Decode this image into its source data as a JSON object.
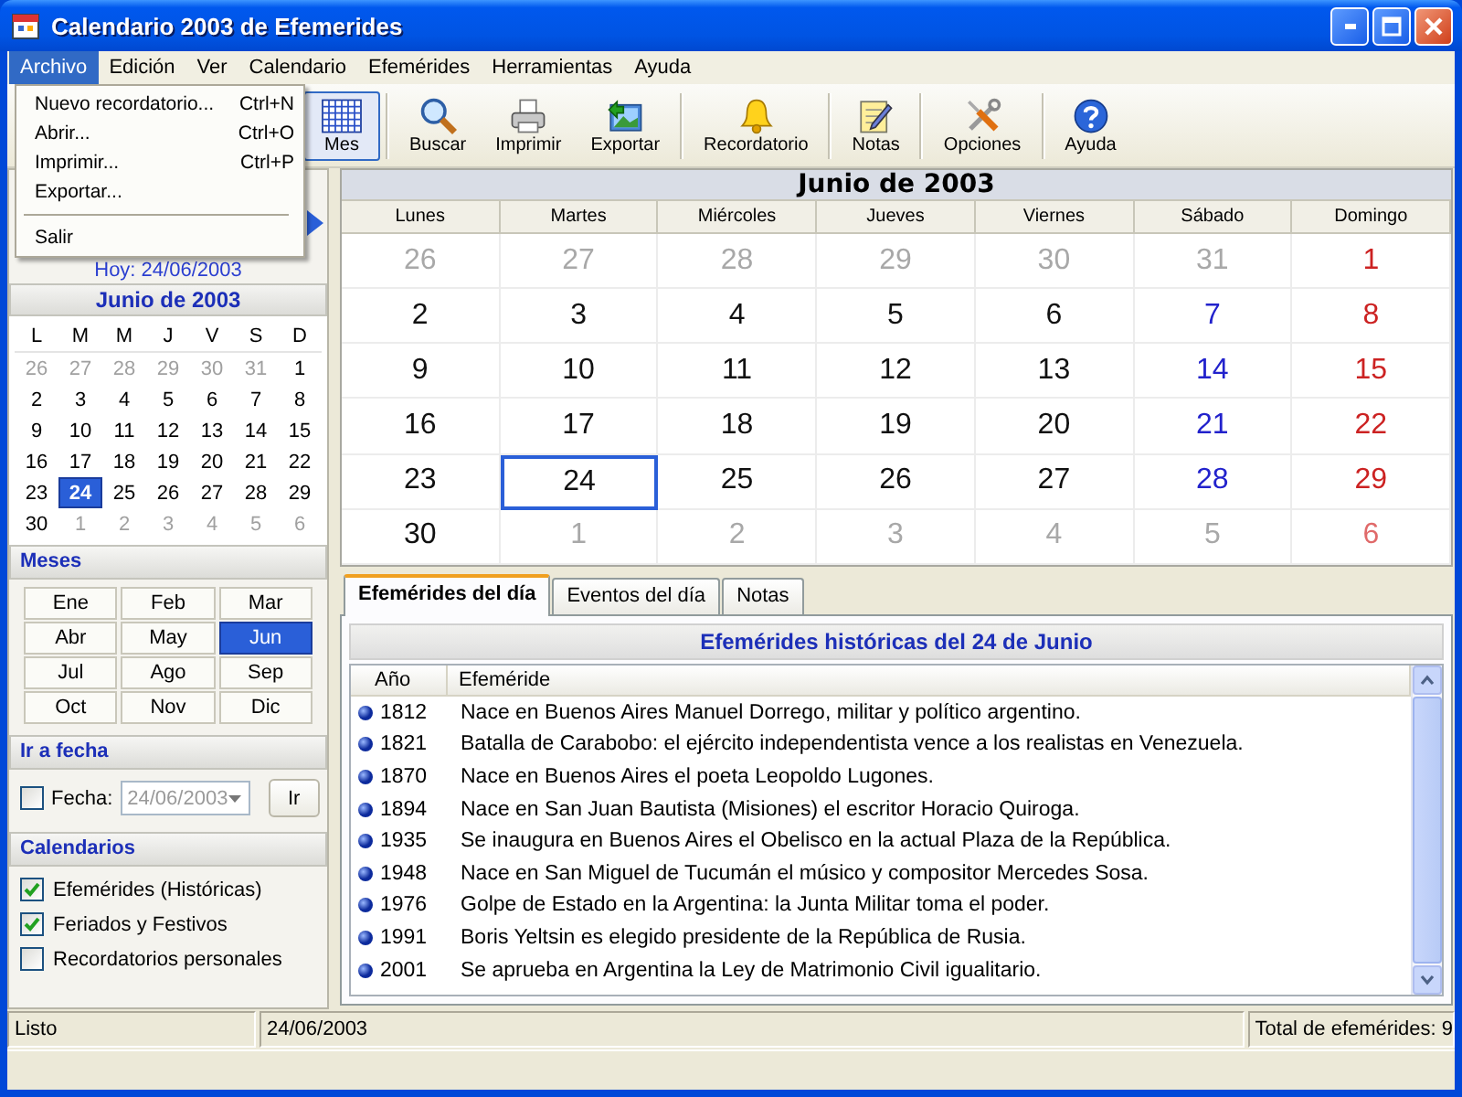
{
  "window": {
    "title": "Calendario 2003 de Efemerides"
  },
  "menu_bar": {
    "items": [
      {
        "label": "Archivo",
        "selected": true
      },
      {
        "label": "Edición",
        "selected": false
      },
      {
        "label": "Ver",
        "selected": false
      },
      {
        "label": "Calendario",
        "selected": false
      },
      {
        "label": "Efemérides",
        "selected": false
      },
      {
        "label": "Herramientas",
        "selected": false
      },
      {
        "label": "Ayuda",
        "selected": false
      }
    ]
  },
  "open_menu": {
    "items": [
      {
        "kind": "item",
        "label": "Nuevo recordatorio...",
        "shortcut": "Ctrl+N"
      },
      {
        "kind": "item",
        "label": "Abrir...",
        "shortcut": "Ctrl+O"
      },
      {
        "kind": "item",
        "label": "Imprimir...",
        "shortcut": "Ctrl+P"
      },
      {
        "kind": "item",
        "label": "Exportar..."
      },
      {
        "kind": "separator"
      },
      {
        "kind": "item",
        "label": "Salir"
      }
    ]
  },
  "toolbar": {
    "groups": [
      [
        {
          "label": "Mes",
          "selected": true
        }
      ],
      [
        {
          "label": "Buscar",
          "selected": false
        },
        {
          "label": "Imprimir",
          "selected": false
        },
        {
          "label": "Exportar",
          "selected": false
        }
      ],
      [
        {
          "label": "Recordatorio",
          "selected": false
        }
      ],
      [
        {
          "label": "Notas",
          "selected": false
        }
      ],
      [
        {
          "label": "Opciones",
          "selected": false
        }
      ],
      [
        {
          "label": "Ayuda",
          "selected": false
        }
      ]
    ]
  },
  "sidebar": {
    "today_label": "Hoy: 24/06/2003",
    "mini_calendar": {
      "title": "Junio de 2003",
      "weekdays": [
        "L",
        "M",
        "M",
        "J",
        "V",
        "S",
        "D"
      ],
      "weeks": [
        [
          {
            "day": "26",
            "in_month": false,
            "selected": false
          },
          {
            "day": "27",
            "in_month": false,
            "selected": false
          },
          {
            "day": "28",
            "in_month": false,
            "selected": false
          },
          {
            "day": "29",
            "in_month": false,
            "selected": false
          },
          {
            "day": "30",
            "in_month": false,
            "selected": false
          },
          {
            "day": "31",
            "in_month": false,
            "selected": false
          },
          {
            "day": "1",
            "in_month": true,
            "selected": false
          }
        ],
        [
          {
            "day": "2",
            "in_month": true,
            "selected": false
          },
          {
            "day": "3",
            "in_month": true,
            "selected": false
          },
          {
            "day": "4",
            "in_month": true,
            "selected": false
          },
          {
            "day": "5",
            "in_month": true,
            "selected": false
          },
          {
            "day": "6",
            "in_month": true,
            "selected": false
          },
          {
            "day": "7",
            "in_month": true,
            "selected": false
          },
          {
            "day": "8",
            "in_month": true,
            "selected": false
          }
        ],
        [
          {
            "day": "9",
            "in_month": true,
            "selected": false
          },
          {
            "day": "10",
            "in_month": true,
            "selected": false
          },
          {
            "day": "11",
            "in_month": true,
            "selected": false
          },
          {
            "day": "12",
            "in_month": true,
            "selected": false
          },
          {
            "day": "13",
            "in_month": true,
            "selected": false
          },
          {
            "day": "14",
            "in_month": true,
            "selected": false
          },
          {
            "day": "15",
            "in_month": true,
            "selected": false
          }
        ],
        [
          {
            "day": "16",
            "in_month": true,
            "selected": false
          },
          {
            "day": "17",
            "in_month": true,
            "selected": false
          },
          {
            "day": "18",
            "in_month": true,
            "selected": false
          },
          {
            "day": "19",
            "in_month": true,
            "selected": false
          },
          {
            "day": "20",
            "in_month": true,
            "selected": false
          },
          {
            "day": "21",
            "in_month": true,
            "selected": false
          },
          {
            "day": "22",
            "in_month": true,
            "selected": false
          }
        ],
        [
          {
            "day": "23",
            "in_month": true,
            "selected": false
          },
          {
            "day": "24",
            "in_month": true,
            "selected": true
          },
          {
            "day": "25",
            "in_month": true,
            "selected": false
          },
          {
            "day": "26",
            "in_month": true,
            "selected": false
          },
          {
            "day": "27",
            "in_month": true,
            "selected": false
          },
          {
            "day": "28",
            "in_month": true,
            "selected": false
          },
          {
            "day": "29",
            "in_month": true,
            "selected": false
          }
        ],
        [
          {
            "day": "30",
            "in_month": true,
            "selected": false
          },
          {
            "day": "1",
            "in_month": false,
            "selected": false
          },
          {
            "day": "2",
            "in_month": false,
            "selected": false
          },
          {
            "day": "3",
            "in_month": false,
            "selected": false
          },
          {
            "day": "4",
            "in_month": false,
            "selected": false
          },
          {
            "day": "5",
            "in_month": false,
            "selected": false
          },
          {
            "day": "6",
            "in_month": false,
            "selected": false
          }
        ]
      ]
    },
    "months": {
      "title": "Meses",
      "items": [
        {
          "label": "Ene",
          "selected": false
        },
        {
          "label": "Feb",
          "selected": false
        },
        {
          "label": "Mar",
          "selected": false
        },
        {
          "label": "Abr",
          "selected": false
        },
        {
          "label": "May",
          "selected": false
        },
        {
          "label": "Jun",
          "selected": true
        },
        {
          "label": "Jul",
          "selected": false
        },
        {
          "label": "Ago",
          "selected": false
        },
        {
          "label": "Sep",
          "selected": false
        },
        {
          "label": "Oct",
          "selected": false
        },
        {
          "label": "Nov",
          "selected": false
        },
        {
          "label": "Dic",
          "selected": false
        }
      ]
    },
    "go_to_date": {
      "title": "Ir a fecha",
      "checkbox": {
        "label": "Fecha:",
        "checked": false
      },
      "date_field": {
        "value": "24/06/2003",
        "disabled": true
      },
      "button": "Ir"
    },
    "calendars": {
      "title": "Calendarios",
      "items": [
        {
          "label": "Efemérides (Históricas)",
          "checked": true
        },
        {
          "label": "Feriados y Festivos",
          "checked": true
        },
        {
          "label": "Recordatorios personales",
          "checked": false
        }
      ]
    }
  },
  "month_view": {
    "title": "Junio de 2003",
    "weekdays": [
      "Lunes",
      "Martes",
      "Miércoles",
      "Jueves",
      "Viernes",
      "Sábado",
      "Domingo"
    ],
    "weeks": [
      [
        {
          "day": "26",
          "in_month": false,
          "selected": false
        },
        {
          "day": "27",
          "in_month": false,
          "selected": false
        },
        {
          "day": "28",
          "in_month": false,
          "selected": false
        },
        {
          "day": "29",
          "in_month": false,
          "selected": false
        },
        {
          "day": "30",
          "in_month": false,
          "selected": false
        },
        {
          "day": "31",
          "in_month": false,
          "selected": false
        },
        {
          "day": "1",
          "in_month": true,
          "selected": false
        }
      ],
      [
        {
          "day": "2",
          "in_month": true,
          "selected": false
        },
        {
          "day": "3",
          "in_month": true,
          "selected": false
        },
        {
          "day": "4",
          "in_month": true,
          "selected": false
        },
        {
          "day": "5",
          "in_month": true,
          "selected": false
        },
        {
          "day": "6",
          "in_month": true,
          "selected": false
        },
        {
          "day": "7",
          "in_month": true,
          "selected": false
        },
        {
          "day": "8",
          "in_month": true,
          "selected": false
        }
      ],
      [
        {
          "day": "9",
          "in_month": true,
          "selected": false
        },
        {
          "day": "10",
          "in_month": true,
          "selected": false
        },
        {
          "day": "11",
          "in_month": true,
          "selected": false
        },
        {
          "day": "12",
          "in_month": true,
          "selected": false
        },
        {
          "day": "13",
          "in_month": true,
          "selected": false
        },
        {
          "day": "14",
          "in_month": true,
          "selected": false
        },
        {
          "day": "15",
          "in_month": true,
          "selected": false
        }
      ],
      [
        {
          "day": "16",
          "in_month": true,
          "selected": false
        },
        {
          "day": "17",
          "in_month": true,
          "selected": false
        },
        {
          "day": "18",
          "in_month": true,
          "selected": false
        },
        {
          "day": "19",
          "in_month": true,
          "selected": false
        },
        {
          "day": "20",
          "in_month": true,
          "selected": false
        },
        {
          "day": "21",
          "in_month": true,
          "selected": false
        },
        {
          "day": "22",
          "in_month": true,
          "selected": false
        }
      ],
      [
        {
          "day": "23",
          "in_month": true,
          "selected": false
        },
        {
          "day": "24",
          "in_month": true,
          "selected": true
        },
        {
          "day": "25",
          "in_month": true,
          "selected": false
        },
        {
          "day": "26",
          "in_month": true,
          "selected": false
        },
        {
          "day": "27",
          "in_month": true,
          "selected": false
        },
        {
          "day": "28",
          "in_month": true,
          "selected": false
        },
        {
          "day": "29",
          "in_month": true,
          "selected": false
        }
      ],
      [
        {
          "day": "30",
          "in_month": true,
          "selected": false
        },
        {
          "day": "1",
          "in_month": false,
          "selected": false
        },
        {
          "day": "2",
          "in_month": false,
          "selected": false
        },
        {
          "day": "3",
          "in_month": false,
          "selected": false
        },
        {
          "day": "4",
          "in_month": false,
          "selected": false
        },
        {
          "day": "5",
          "in_month": false,
          "selected": false
        },
        {
          "day": "6",
          "in_month": false,
          "selected": false
        }
      ]
    ]
  },
  "day_panel": {
    "tabs": [
      {
        "label": "Efemérides del día",
        "selected": true
      },
      {
        "label": "Eventos del día",
        "selected": false
      },
      {
        "label": "Notas",
        "selected": false
      }
    ],
    "header": "Efemérides históricas del 24 de Junio",
    "columns": [
      "Año",
      "Efeméride"
    ],
    "rows": [
      {
        "year": "1812",
        "text": "Nace en Buenos Aires Manuel Dorrego, militar y político argentino."
      },
      {
        "year": "1821",
        "text": "Batalla de Carabobo: el ejército independentista vence a los realistas en Venezuela."
      },
      {
        "year": "1870",
        "text": "Nace en Buenos Aires el poeta Leopoldo Lugones."
      },
      {
        "year": "1894",
        "text": "Nace en San Juan Bautista (Misiones) el escritor Horacio Quiroga."
      },
      {
        "year": "1935",
        "text": "Se inaugura en Buenos Aires el Obelisco en la actual Plaza de la República."
      },
      {
        "year": "1948",
        "text": "Nace en San Miguel de Tucumán el músico y compositor Mercedes Sosa."
      },
      {
        "year": "1976",
        "text": "Golpe de Estado en la Argentina: la Junta Militar toma el poder."
      },
      {
        "year": "1991",
        "text": "Boris Yeltsin es elegido presidente de la República de Rusia."
      },
      {
        "year": "2001",
        "text": "Se aprueba en Argentina la Ley de Matrimonio Civil igualitario."
      }
    ]
  },
  "status_bar": [
    "Listo",
    "24/06/2003",
    "Total de efemérides: 9"
  ]
}
